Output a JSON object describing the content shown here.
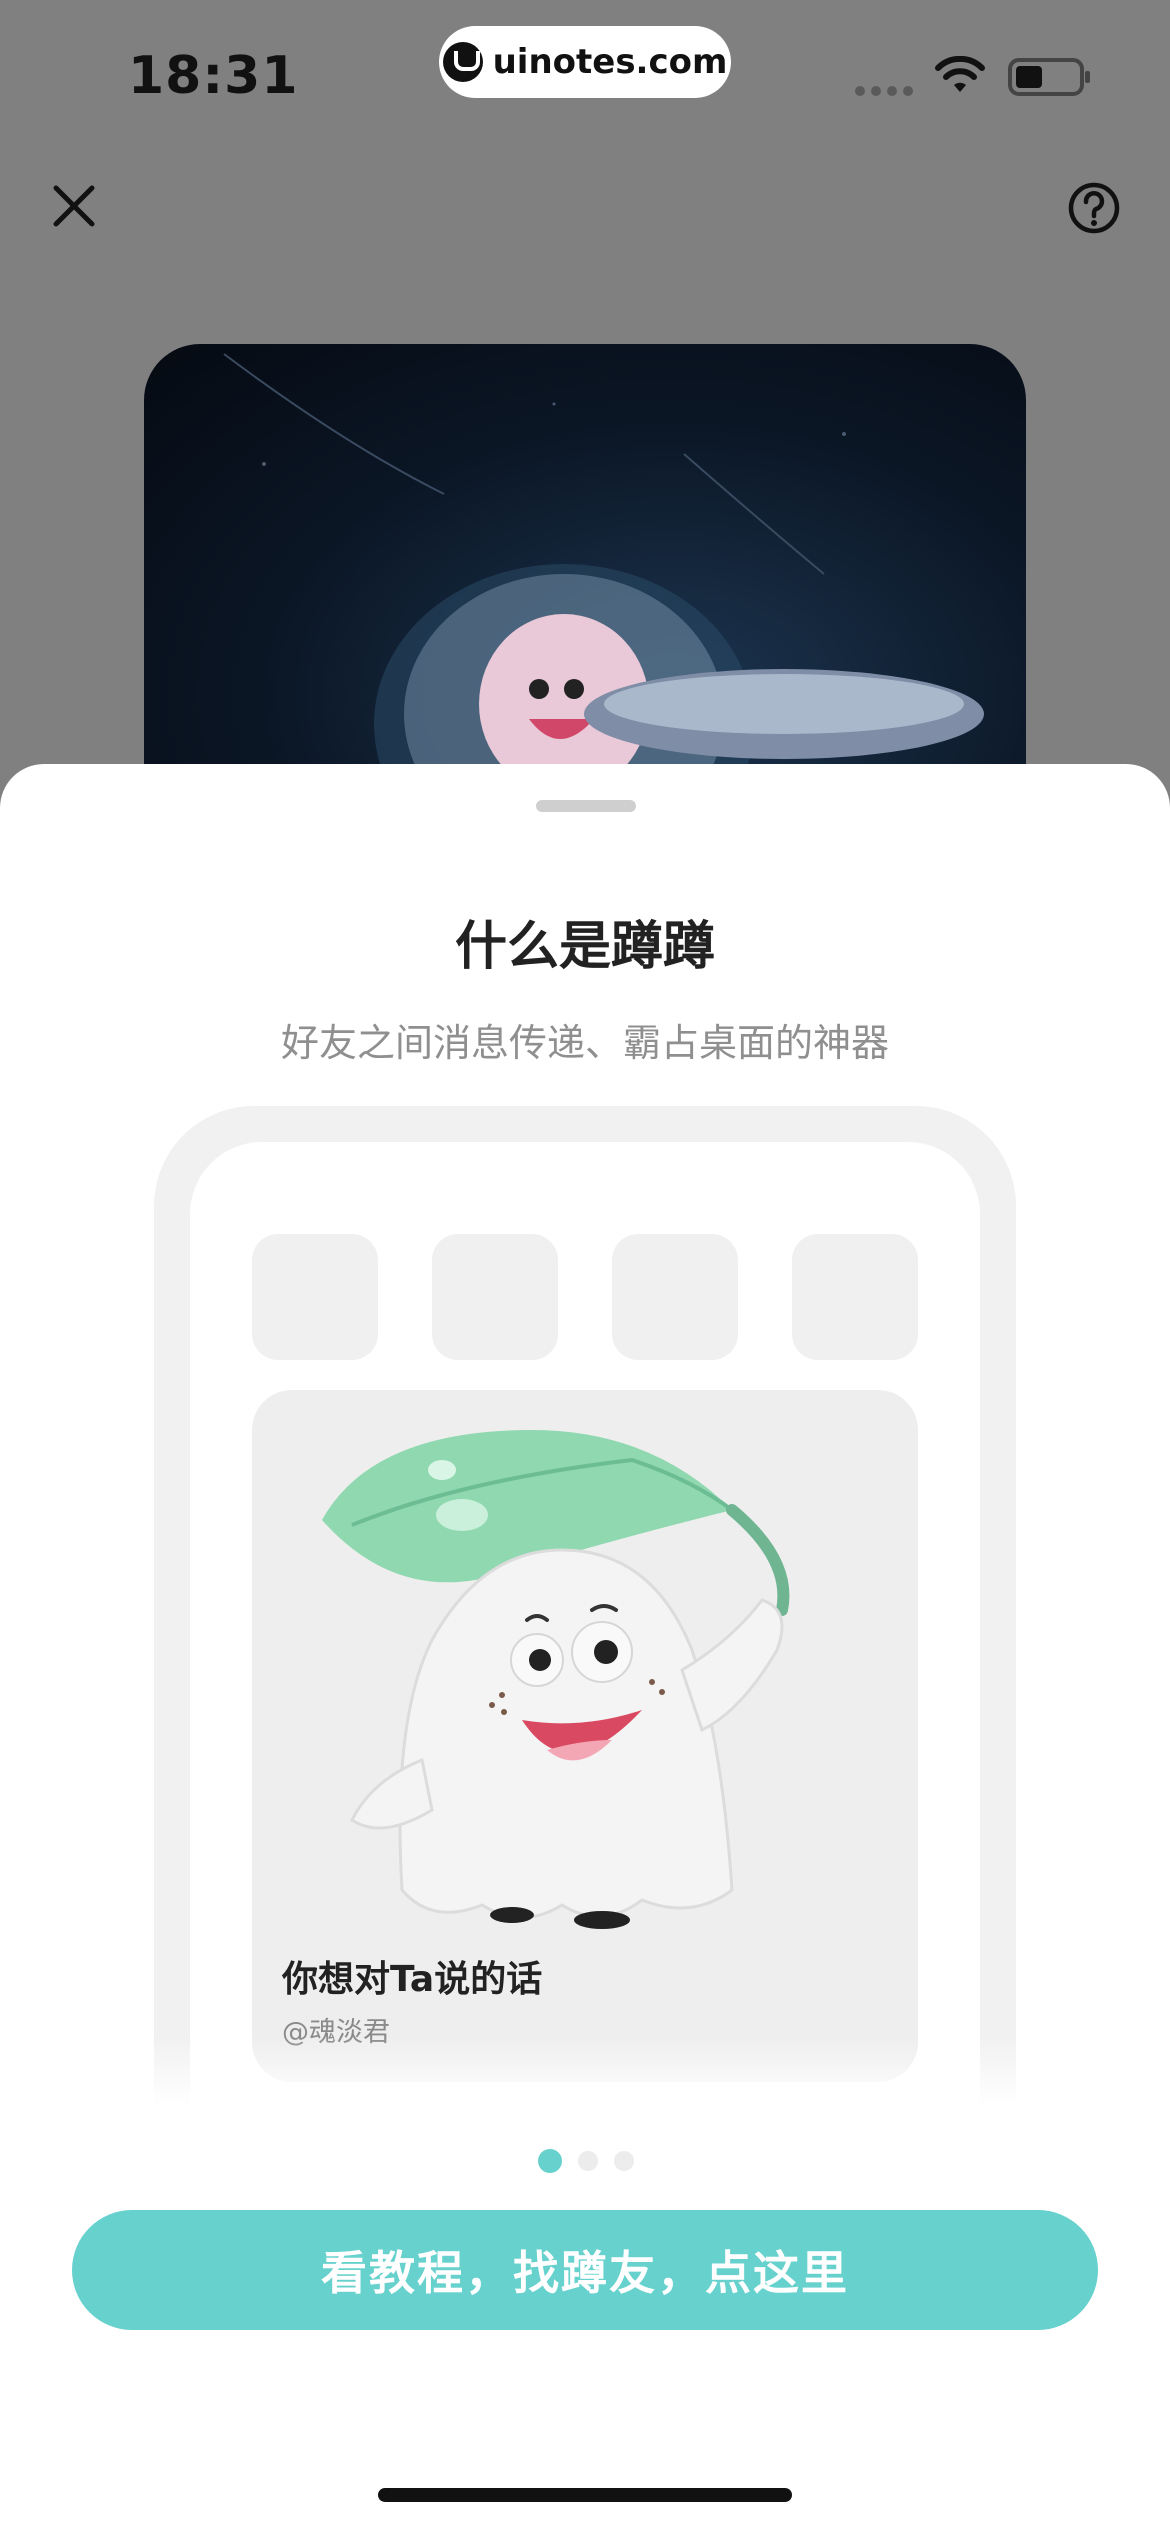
{
  "status_bar": {
    "time": "18:31",
    "url": "uinotes.com"
  },
  "top_bar": {
    "close_icon": "close-icon",
    "help_icon": "question-circle-icon"
  },
  "sheet": {
    "title": "什么是蹲蹲",
    "subtitle": "好友之间消息传递、霸占桌面的神器",
    "widget": {
      "message": "你想对Ta说的话",
      "author": "@魂淡君"
    },
    "pager": {
      "total": 3,
      "active_index": 0
    },
    "cta_label": "看教程，找蹲友，点这里"
  },
  "colors": {
    "accent": "#66d1cd",
    "overlay": "#808080",
    "title_text": "#222222",
    "subtitle_text": "#8f8f8f"
  }
}
